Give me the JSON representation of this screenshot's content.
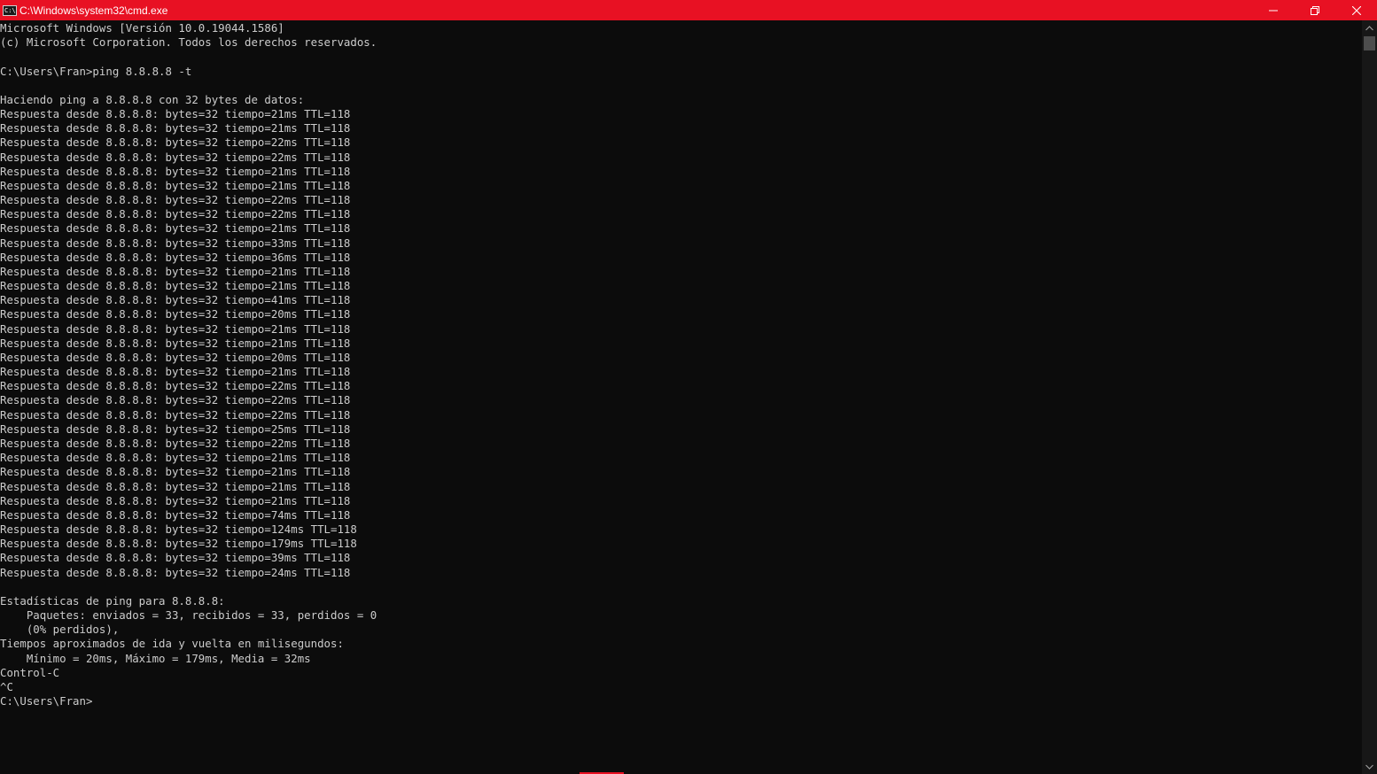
{
  "window": {
    "title": "C:\\Windows\\system32\\cmd.exe",
    "icon": "cmd-icon",
    "icon_text": "C:\\",
    "accent": "#e81123",
    "controls": [
      "minimize-icon",
      "restore-icon",
      "close-icon"
    ]
  },
  "console": {
    "background": "#0c0c0c",
    "foreground": "#cccccc",
    "lines": [
      "Microsoft Windows [Versión 10.0.19044.1586]",
      "(c) Microsoft Corporation. Todos los derechos reservados.",
      "",
      "C:\\Users\\Fran>ping 8.8.8.8 -t",
      "",
      "Haciendo ping a 8.8.8.8 con 32 bytes de datos:",
      "Respuesta desde 8.8.8.8: bytes=32 tiempo=21ms TTL=118",
      "Respuesta desde 8.8.8.8: bytes=32 tiempo=21ms TTL=118",
      "Respuesta desde 8.8.8.8: bytes=32 tiempo=22ms TTL=118",
      "Respuesta desde 8.8.8.8: bytes=32 tiempo=22ms TTL=118",
      "Respuesta desde 8.8.8.8: bytes=32 tiempo=21ms TTL=118",
      "Respuesta desde 8.8.8.8: bytes=32 tiempo=21ms TTL=118",
      "Respuesta desde 8.8.8.8: bytes=32 tiempo=22ms TTL=118",
      "Respuesta desde 8.8.8.8: bytes=32 tiempo=22ms TTL=118",
      "Respuesta desde 8.8.8.8: bytes=32 tiempo=21ms TTL=118",
      "Respuesta desde 8.8.8.8: bytes=32 tiempo=33ms TTL=118",
      "Respuesta desde 8.8.8.8: bytes=32 tiempo=36ms TTL=118",
      "Respuesta desde 8.8.8.8: bytes=32 tiempo=21ms TTL=118",
      "Respuesta desde 8.8.8.8: bytes=32 tiempo=21ms TTL=118",
      "Respuesta desde 8.8.8.8: bytes=32 tiempo=41ms TTL=118",
      "Respuesta desde 8.8.8.8: bytes=32 tiempo=20ms TTL=118",
      "Respuesta desde 8.8.8.8: bytes=32 tiempo=21ms TTL=118",
      "Respuesta desde 8.8.8.8: bytes=32 tiempo=21ms TTL=118",
      "Respuesta desde 8.8.8.8: bytes=32 tiempo=20ms TTL=118",
      "Respuesta desde 8.8.8.8: bytes=32 tiempo=21ms TTL=118",
      "Respuesta desde 8.8.8.8: bytes=32 tiempo=22ms TTL=118",
      "Respuesta desde 8.8.8.8: bytes=32 tiempo=22ms TTL=118",
      "Respuesta desde 8.8.8.8: bytes=32 tiempo=22ms TTL=118",
      "Respuesta desde 8.8.8.8: bytes=32 tiempo=25ms TTL=118",
      "Respuesta desde 8.8.8.8: bytes=32 tiempo=22ms TTL=118",
      "Respuesta desde 8.8.8.8: bytes=32 tiempo=21ms TTL=118",
      "Respuesta desde 8.8.8.8: bytes=32 tiempo=21ms TTL=118",
      "Respuesta desde 8.8.8.8: bytes=32 tiempo=21ms TTL=118",
      "Respuesta desde 8.8.8.8: bytes=32 tiempo=21ms TTL=118",
      "Respuesta desde 8.8.8.8: bytes=32 tiempo=74ms TTL=118",
      "Respuesta desde 8.8.8.8: bytes=32 tiempo=124ms TTL=118",
      "Respuesta desde 8.8.8.8: bytes=32 tiempo=179ms TTL=118",
      "Respuesta desde 8.8.8.8: bytes=32 tiempo=39ms TTL=118",
      "Respuesta desde 8.8.8.8: bytes=32 tiempo=24ms TTL=118",
      "",
      "Estadísticas de ping para 8.8.8.8:",
      "    Paquetes: enviados = 33, recibidos = 33, perdidos = 0",
      "    (0% perdidos),",
      "Tiempos aproximados de ida y vuelta en milisegundos:",
      "    Mínimo = 20ms, Máximo = 179ms, Media = 32ms",
      "Control-C",
      "^C",
      "C:\\Users\\Fran>"
    ]
  },
  "scrollbar": {
    "up_icon": "scroll-up-arrow-icon",
    "down_icon": "scroll-down-arrow-icon"
  }
}
